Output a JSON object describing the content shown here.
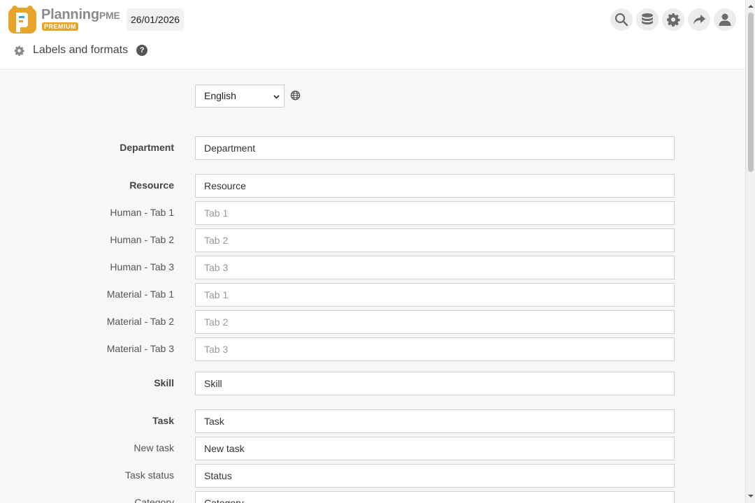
{
  "header": {
    "logo_text": "Planning",
    "logo_suffix": "PME",
    "logo_badge": "PREMIUM",
    "date": "26/01/2026"
  },
  "toolbar": {
    "icons": [
      "search-icon",
      "database-icon",
      "gear-icon",
      "share-icon",
      "user-icon"
    ]
  },
  "page": {
    "title": "Labels and formats",
    "help": "?"
  },
  "language": {
    "selected": "English"
  },
  "fields": [
    {
      "label": "Department",
      "value": "Department",
      "placeholder": false,
      "bold": true
    },
    {
      "label": "Resource",
      "value": "Resource",
      "placeholder": false,
      "bold": true
    },
    {
      "label": "Human - Tab 1",
      "value": "Tab 1",
      "placeholder": true,
      "bold": false
    },
    {
      "label": "Human - Tab 2",
      "value": "Tab 2",
      "placeholder": true,
      "bold": false
    },
    {
      "label": "Human - Tab 3",
      "value": "Tab 3",
      "placeholder": true,
      "bold": false
    },
    {
      "label": "Material - Tab 1",
      "value": "Tab 1",
      "placeholder": true,
      "bold": false
    },
    {
      "label": "Material - Tab 2",
      "value": "Tab 2",
      "placeholder": true,
      "bold": false
    },
    {
      "label": "Material - Tab 3",
      "value": "Tab 3",
      "placeholder": true,
      "bold": false
    },
    {
      "label": "Skill",
      "value": "Skill",
      "placeholder": false,
      "bold": true
    },
    {
      "label": "Task",
      "value": "Task",
      "placeholder": false,
      "bold": true
    },
    {
      "label": "New task",
      "value": "New task",
      "placeholder": false,
      "bold": false
    },
    {
      "label": "Task status",
      "value": "Status",
      "placeholder": false,
      "bold": false
    },
    {
      "label": "Category",
      "value": "Category",
      "placeholder": false,
      "bold": false
    }
  ],
  "colors": {
    "brand": "#e6a52a",
    "background": "#f7f7f7"
  }
}
